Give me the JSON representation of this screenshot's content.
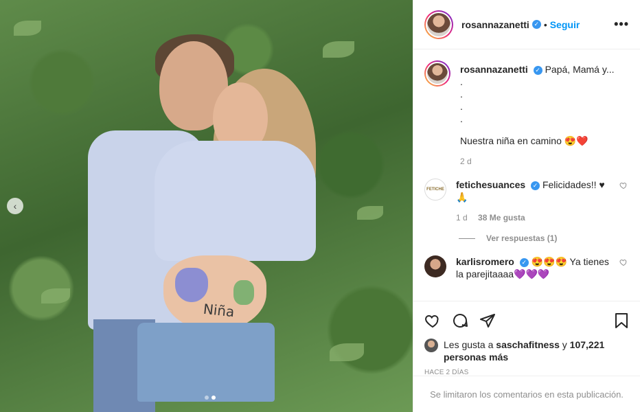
{
  "post": {
    "author": "rosannazanetti",
    "follow_label": "Seguir",
    "separator": "•",
    "more_label": "•••",
    "caption_lines": [
      "Papá, Mamá y...",
      ".",
      ".",
      ".",
      ".",
      "Nuestra niña en camino 😍❤️"
    ],
    "caption_age": "2 d",
    "photo_text": "Niña",
    "nav_prev": "‹"
  },
  "comments": [
    {
      "user": "fetichesuances",
      "avatar_text": "FETICHE",
      "text": "Felicidades!! ♥ 🙏",
      "age": "1 d",
      "likes": "38 Me gusta",
      "replies_label": "Ver respuestas (1)"
    },
    {
      "user": "karlisromero",
      "text": "😍😍😍 Ya tienes la parejitaaaa💜💜💜"
    }
  ],
  "likes": {
    "prefix": "Les gusta a",
    "user": "saschafitness",
    "connector": "y",
    "count": "107,221 personas más"
  },
  "timestamp": "Hace 2 días",
  "comments_limited": "Se limitaron los comentarios en esta publicación.",
  "icons": {
    "like": "heart-icon",
    "comment": "comment-icon",
    "share": "share-icon",
    "save": "bookmark-icon"
  },
  "colors": {
    "link": "#0095f6",
    "verified": "#3897f0",
    "muted": "#8e8e8e"
  }
}
